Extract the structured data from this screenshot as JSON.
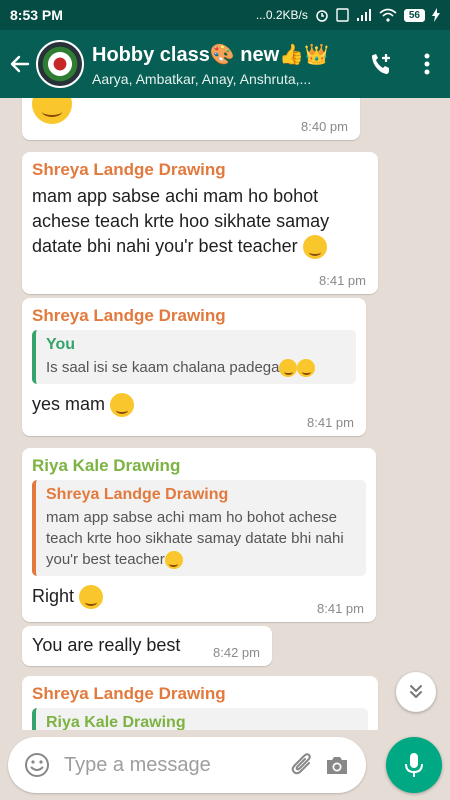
{
  "status_bar": {
    "time": "8:53 PM",
    "network_speed": "...0.2KB/s",
    "battery": "56"
  },
  "header": {
    "group_name": "Hobby class🎨 new👍👑",
    "members": "Aarya, Ambatkar, Anay, Anshruta,..."
  },
  "messages": [
    {
      "sender": "",
      "text": "",
      "time": "8:40 pm"
    },
    {
      "sender": "Shreya Landge Drawing",
      "text": "mam app sabse achi mam ho bohot achese teach  krte hoo sikhate samay datate  bhi nahi you'r best teacher",
      "time": "8:41 pm"
    },
    {
      "sender": "Shreya Landge Drawing",
      "quote": {
        "sender": "You",
        "text": "Is saal isi se kaam chalana padega"
      },
      "text": "yes mam",
      "time": "8:41 pm"
    },
    {
      "sender": "Riya Kale Drawing",
      "quote": {
        "sender": "Shreya Landge Drawing",
        "text": "mam app sabse achi mam ho bohot achese teach  krte hoo sikhate samay datate  bhi nahi you'r best teacher"
      },
      "text": "Right",
      "time": "8:41 pm"
    },
    {
      "sender": "",
      "text": "You are really best",
      "time": "8:42 pm"
    },
    {
      "sender": "Shreya Landge Drawing",
      "quote": {
        "sender": "Riya Kale Drawing",
        "text": ""
      },
      "text": "",
      "time": ""
    }
  ],
  "input": {
    "placeholder": "Type a message"
  },
  "colors": {
    "header_green": "#075e54",
    "status_bar": "#054d44",
    "chat_background": "#e5ddd5",
    "mic_button": "#00a884",
    "sender_orange": "#e27a3e",
    "sender_green": "#7cb342",
    "quote_green": "#35a36b"
  },
  "icons": [
    "back-arrow-icon",
    "add-call-icon",
    "more-options-icon",
    "scroll-down-icon",
    "emoji-icon",
    "attach-icon",
    "camera-icon",
    "mic-icon"
  ]
}
